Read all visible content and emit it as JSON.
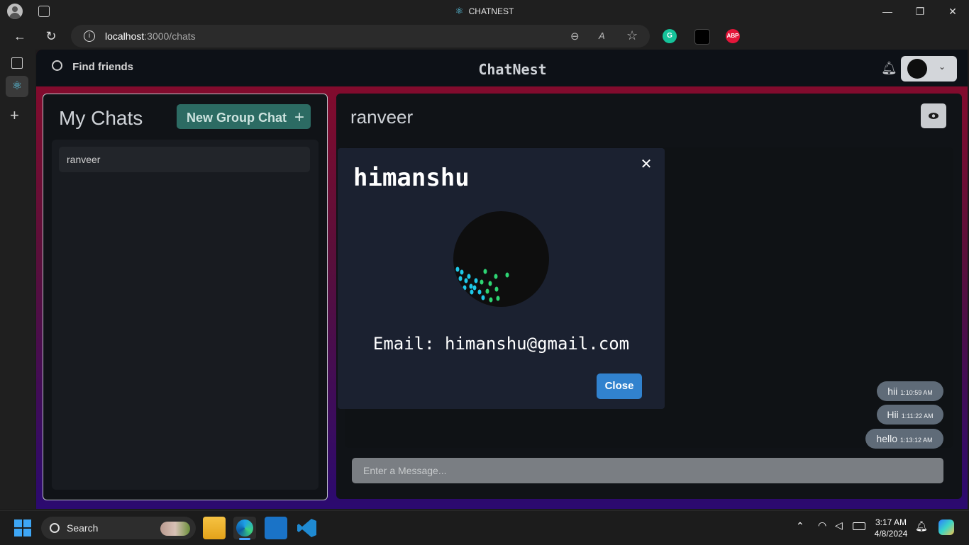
{
  "browser": {
    "window_title": "CHATNEST",
    "url_host": "localhost",
    "url_path": ":3000/chats",
    "ext_labels": {
      "abp": "ABP"
    }
  },
  "app": {
    "brand": "ChatNest",
    "search_label": "Find friends",
    "my_chats_title": "My Chats",
    "new_group_label": "New Group Chat",
    "chats": [
      {
        "name": "ranveer"
      }
    ],
    "current_chat": {
      "name": "ranveer"
    },
    "messages": [
      {
        "text": "hii",
        "time": "1:10:59 AM"
      },
      {
        "text": "Hii",
        "time": "1:11:22 AM"
      },
      {
        "text": "hello",
        "time": "1:13:12 AM"
      }
    ],
    "message_placeholder": "Enter a Message..."
  },
  "modal": {
    "name": "himanshu",
    "email_text": "Email: himanshu@gmail.com",
    "close_label": "Close"
  },
  "taskbar": {
    "search_label": "Search",
    "time": "3:17 AM",
    "date": "4/8/2024"
  },
  "colors": {
    "modal_bg": "#1b2130",
    "close_button": "#3182ce",
    "new_group_button": "#2c6b63",
    "bubble": "#5f6b78"
  }
}
